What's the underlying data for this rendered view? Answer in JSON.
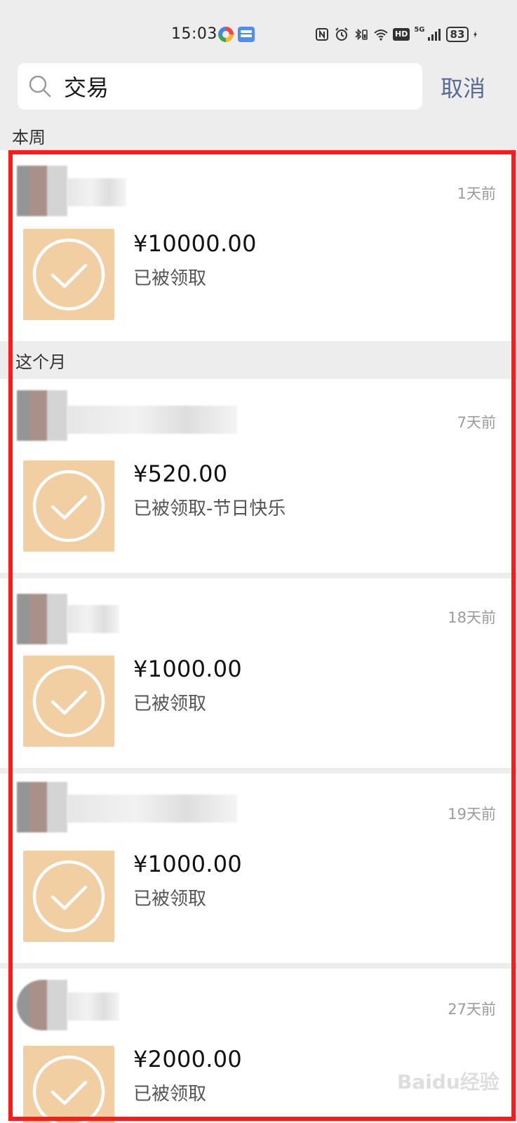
{
  "status_bar": {
    "time": "15:03",
    "network_label": "5G",
    "hd_label": "HD",
    "battery": "83"
  },
  "search": {
    "query": "交易",
    "cancel_label": "取消"
  },
  "sections": {
    "this_week": "本周",
    "this_month": "这个月"
  },
  "transactions": [
    {
      "time": "1天前",
      "amount": "¥10000.00",
      "status": "已被领取"
    },
    {
      "time": "7天前",
      "amount": "¥520.00",
      "status": "已被领取-节日快乐"
    },
    {
      "time": "18天前",
      "amount": "¥1000.00",
      "status": "已被领取"
    },
    {
      "time": "19天前",
      "amount": "¥1000.00",
      "status": "已被领取"
    },
    {
      "time": "27天前",
      "amount": "¥2000.00",
      "status": "已被领取"
    }
  ],
  "watermark": "Baidu经验",
  "colors": {
    "accent": "#576b95",
    "thumb_bg": "#f2cfa3",
    "highlight_frame": "#ff1a1a"
  }
}
